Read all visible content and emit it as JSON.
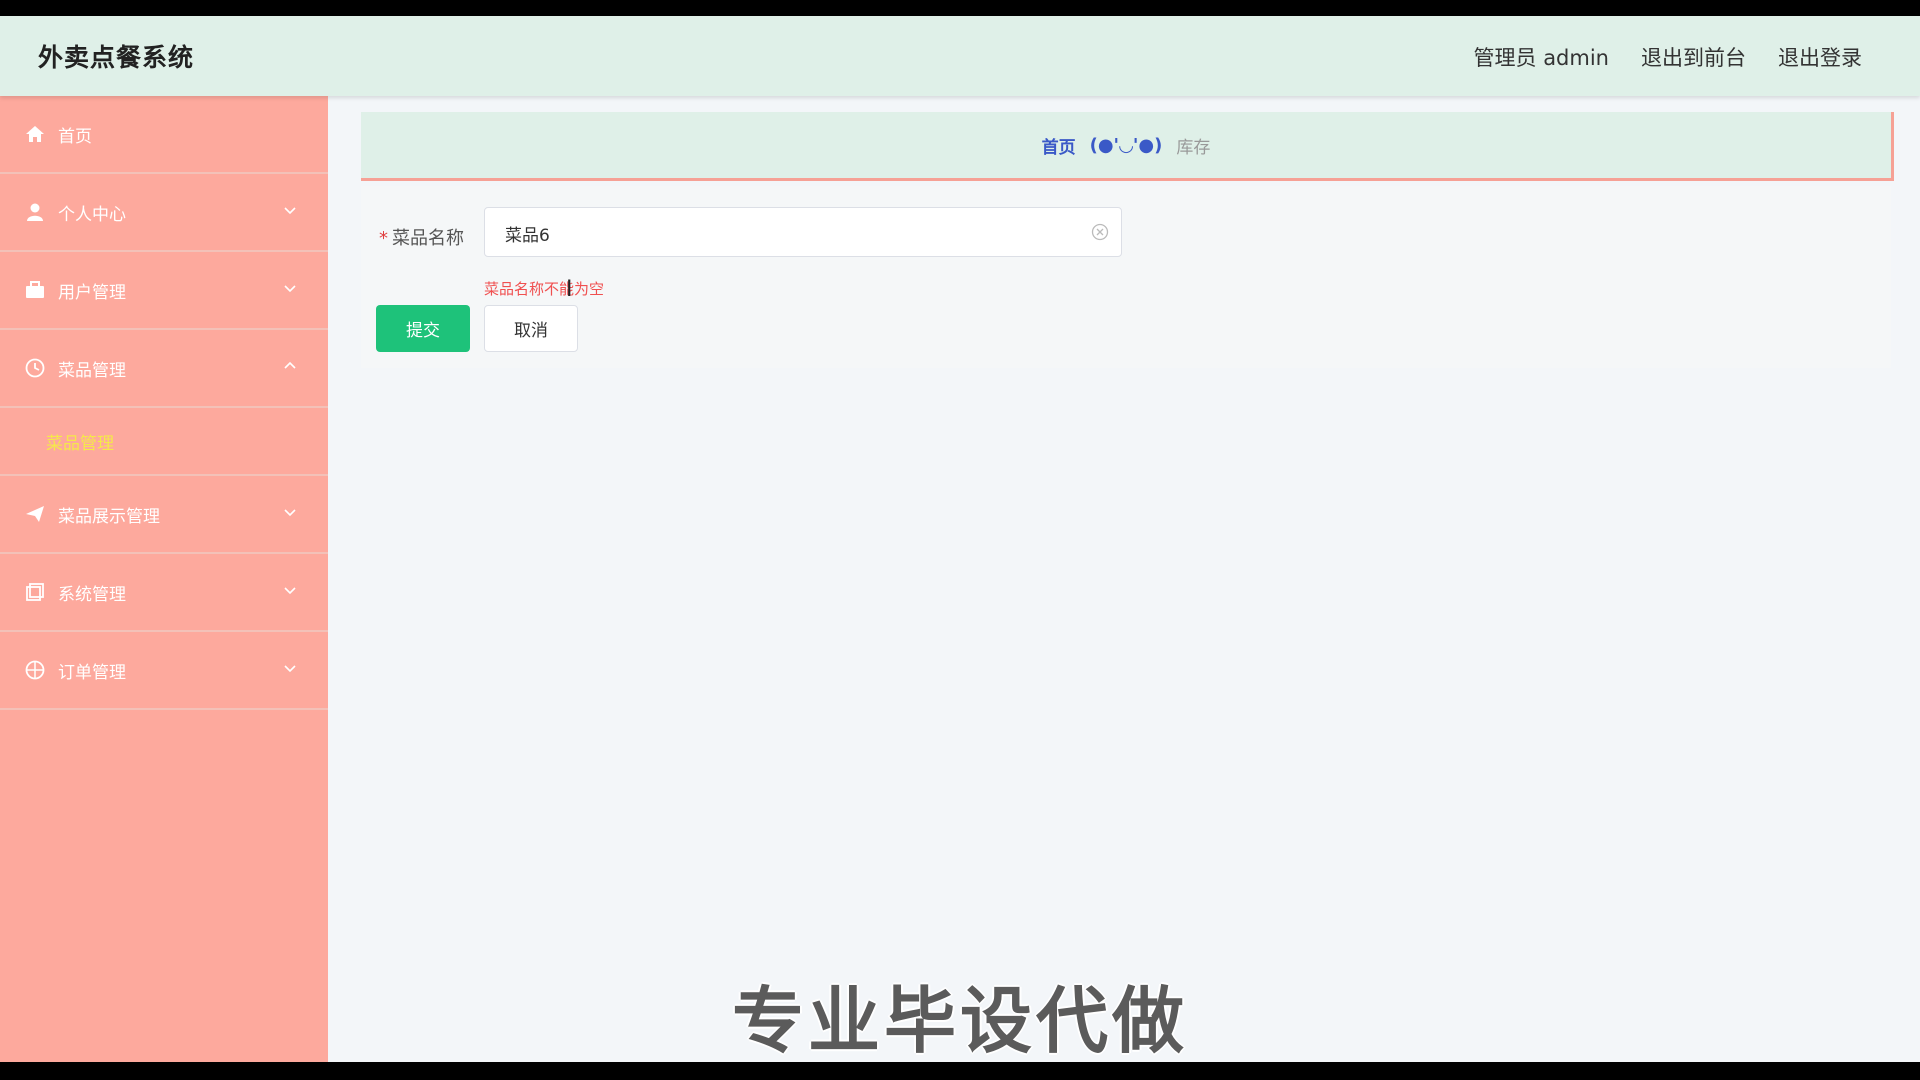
{
  "header": {
    "title": "外卖点餐系统",
    "admin_label": "管理员 admin",
    "front_link": "退出到前台",
    "logout_link": "退出登录"
  },
  "sidebar": {
    "items": [
      {
        "label": "首页",
        "icon": "home-icon"
      },
      {
        "label": "个人中心",
        "icon": "user-icon"
      },
      {
        "label": "用户管理",
        "icon": "briefcase-icon"
      },
      {
        "label": "菜品管理",
        "icon": "clock-icon"
      },
      {
        "label": "菜品展示管理",
        "icon": "send-icon"
      },
      {
        "label": "系统管理",
        "icon": "copy-icon"
      },
      {
        "label": "订单管理",
        "icon": "globe-icon"
      }
    ],
    "active_sub": "菜品管理"
  },
  "breadcrumb": {
    "home": "首页",
    "emoji": "(●'◡'●)",
    "current": "库存"
  },
  "form": {
    "name_label": "菜品名称",
    "required_mark": "*",
    "name_value": "菜品6",
    "error": "菜品名称不能为空",
    "submit": "提交",
    "cancel": "取消"
  },
  "overlay": {
    "watermark": "专业毕设代做"
  },
  "colors": {
    "sidebar_bg": "#fda99d",
    "header_bg": "#dff0e8",
    "submit_bg": "#1ec27a",
    "active_sub": "#f5e84a",
    "error": "#f05050"
  }
}
